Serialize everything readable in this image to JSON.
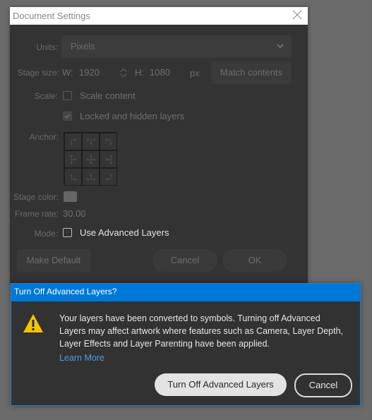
{
  "main_dialog": {
    "title": "Document Settings",
    "close_icon": "close-icon",
    "units": {
      "label": "Units:",
      "value": "Pixels"
    },
    "stage_size": {
      "label": "Stage size:",
      "w_label": "W:",
      "w_value": "1920",
      "h_label": "H:",
      "h_value": "1080",
      "unit": "px",
      "link_icon": "link-constrain-icon",
      "match_contents_label": "Match contents"
    },
    "scale": {
      "label": "Scale:",
      "scale_content": {
        "label": "Scale content",
        "checked": false
      },
      "locked_hidden": {
        "label": "Locked and hidden layers",
        "checked": true
      }
    },
    "anchor": {
      "label": "Anchor:",
      "cells": [
        "top-left",
        "top-center",
        "top-right",
        "middle-left",
        "center",
        "middle-right",
        "bottom-left",
        "bottom-center",
        "bottom-right"
      ]
    },
    "stage_color": {
      "label": "Stage color:",
      "color": "#666666"
    },
    "frame_rate": {
      "label": "Frame rate:",
      "value": "30.00"
    },
    "mode": {
      "label": "Mode:",
      "option_label": "Use Advanced Layers",
      "checked": false
    },
    "buttons": {
      "make_default": "Make Default",
      "cancel": "Cancel",
      "ok": "OK"
    }
  },
  "alert_dialog": {
    "title": "Turn Off Advanced Layers?",
    "icon": "warning-icon",
    "message": "Your layers have been converted to symbols. Turning off Advanced Layers may affect artwork where features such as Camera, Layer Depth, Layer Effects and Layer Parenting have been applied.",
    "link": "Learn More",
    "primary_button": "Turn Off Advanced Layers",
    "cancel_button": "Cancel",
    "accent_color": "#0078d7",
    "warning_color": "#f5c400",
    "link_color": "#4d9ce8"
  }
}
